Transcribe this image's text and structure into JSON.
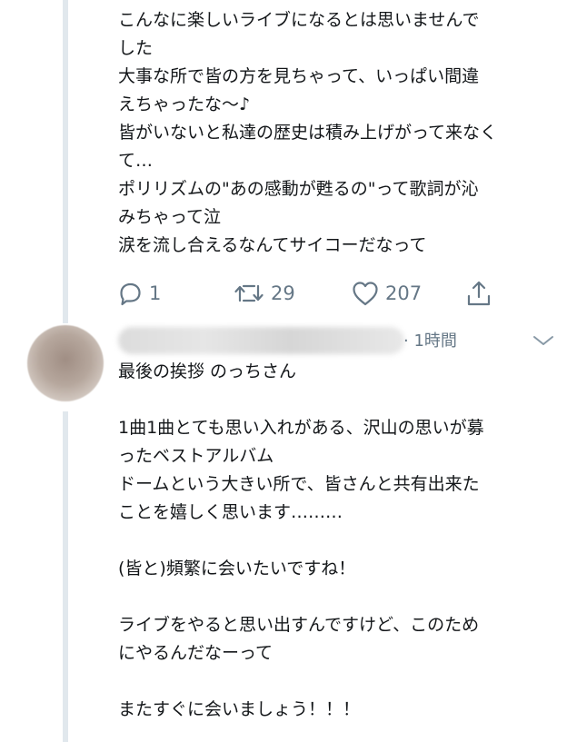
{
  "first_tweet": {
    "text": "こんなに楽しいライブになるとは思いませんで\nした\n大事な所で皆の方を見ちゃって、いっぱい間違\nえちゃったな〜♪\n皆がいないと私達の歴史は積み上げがって来なく\nて…\nポリリズムの\"あの感動が甦るの\"って歌詞が沁\nみちゃって泣\n涙を流し合えるなんてサイコーだなって",
    "actions": {
      "reply_count": "1",
      "retweet_count": "29",
      "like_count": "207"
    }
  },
  "reply_tweet": {
    "timestamp": "· 1時間",
    "text": "最後の挨拶 のっちさん\n\n1曲1曲とても思い入れがある、沢山の思いが募\nったベストアルバム\nドームという大きい所で、皆さんと共有出来た\nことを嬉しく思います………\n\n(皆と)頻繁に会いたいですね！\n\nライブをやると思い出すんですけど、このため\nにやるんだなーって\n\nまたすぐに会いましょう！！！"
  },
  "icons": {
    "reply": "reply-icon",
    "retweet": "retweet-icon",
    "like": "like-icon",
    "share": "share-icon",
    "menu": "chevron-down-icon"
  },
  "colors": {
    "text": "#14171a",
    "secondary": "#657786",
    "thread_line": "#e1e8ed"
  }
}
